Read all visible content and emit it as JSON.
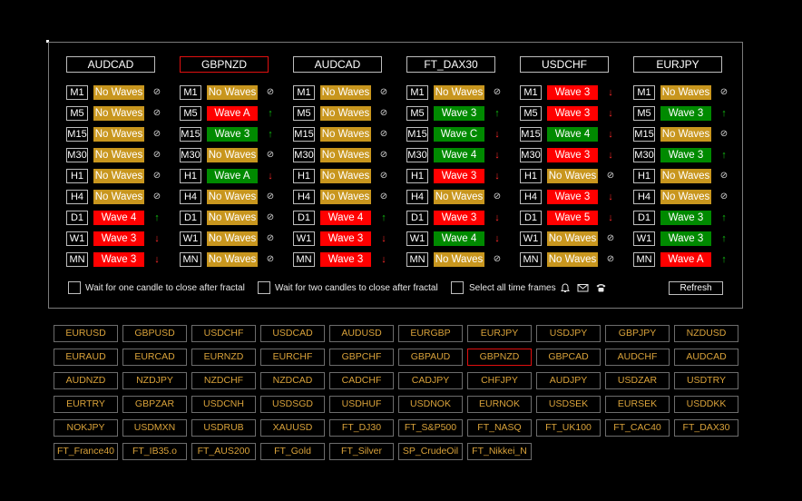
{
  "columns": [
    {
      "symbol": "AUDCAD",
      "selected": false,
      "rows": [
        {
          "tf": "M1",
          "wave": "No Waves",
          "state": "none",
          "dir": "flat"
        },
        {
          "tf": "M5",
          "wave": "No Waves",
          "state": "none",
          "dir": "flat"
        },
        {
          "tf": "M15",
          "wave": "No Waves",
          "state": "none",
          "dir": "flat"
        },
        {
          "tf": "M30",
          "wave": "No Waves",
          "state": "none",
          "dir": "flat"
        },
        {
          "tf": "H1",
          "wave": "No Waves",
          "state": "none",
          "dir": "flat"
        },
        {
          "tf": "H4",
          "wave": "No Waves",
          "state": "none",
          "dir": "flat"
        },
        {
          "tf": "D1",
          "wave": "Wave 4",
          "state": "red",
          "dir": "up"
        },
        {
          "tf": "W1",
          "wave": "Wave 3",
          "state": "red",
          "dir": "down"
        },
        {
          "tf": "MN",
          "wave": "Wave 3",
          "state": "red",
          "dir": "down"
        }
      ]
    },
    {
      "symbol": "GBPNZD",
      "selected": true,
      "rows": [
        {
          "tf": "M1",
          "wave": "No Waves",
          "state": "none",
          "dir": "flat"
        },
        {
          "tf": "M5",
          "wave": "Wave A",
          "state": "red",
          "dir": "up"
        },
        {
          "tf": "M15",
          "wave": "Wave 3",
          "state": "green",
          "dir": "up"
        },
        {
          "tf": "M30",
          "wave": "No Waves",
          "state": "none",
          "dir": "flat"
        },
        {
          "tf": "H1",
          "wave": "Wave A",
          "state": "green",
          "dir": "down"
        },
        {
          "tf": "H4",
          "wave": "No Waves",
          "state": "none",
          "dir": "flat"
        },
        {
          "tf": "D1",
          "wave": "No Waves",
          "state": "none",
          "dir": "flat"
        },
        {
          "tf": "W1",
          "wave": "No Waves",
          "state": "none",
          "dir": "flat"
        },
        {
          "tf": "MN",
          "wave": "No Waves",
          "state": "none",
          "dir": "flat"
        }
      ]
    },
    {
      "symbol": "AUDCAD",
      "selected": false,
      "rows": [
        {
          "tf": "M1",
          "wave": "No Waves",
          "state": "none",
          "dir": "flat"
        },
        {
          "tf": "M5",
          "wave": "No Waves",
          "state": "none",
          "dir": "flat"
        },
        {
          "tf": "M15",
          "wave": "No Waves",
          "state": "none",
          "dir": "flat"
        },
        {
          "tf": "M30",
          "wave": "No Waves",
          "state": "none",
          "dir": "flat"
        },
        {
          "tf": "H1",
          "wave": "No Waves",
          "state": "none",
          "dir": "flat"
        },
        {
          "tf": "H4",
          "wave": "No Waves",
          "state": "none",
          "dir": "flat"
        },
        {
          "tf": "D1",
          "wave": "Wave 4",
          "state": "red",
          "dir": "up"
        },
        {
          "tf": "W1",
          "wave": "Wave 3",
          "state": "red",
          "dir": "down"
        },
        {
          "tf": "MN",
          "wave": "Wave 3",
          "state": "red",
          "dir": "down"
        }
      ]
    },
    {
      "symbol": "FT_DAX30",
      "selected": false,
      "rows": [
        {
          "tf": "M1",
          "wave": "No Waves",
          "state": "none",
          "dir": "flat"
        },
        {
          "tf": "M5",
          "wave": "Wave 3",
          "state": "green",
          "dir": "up"
        },
        {
          "tf": "M15",
          "wave": "Wave C",
          "state": "green",
          "dir": "down"
        },
        {
          "tf": "M30",
          "wave": "Wave 4",
          "state": "green",
          "dir": "down"
        },
        {
          "tf": "H1",
          "wave": "Wave 3",
          "state": "red",
          "dir": "down"
        },
        {
          "tf": "H4",
          "wave": "No Waves",
          "state": "none",
          "dir": "flat"
        },
        {
          "tf": "D1",
          "wave": "Wave 3",
          "state": "red",
          "dir": "down"
        },
        {
          "tf": "W1",
          "wave": "Wave 4",
          "state": "green",
          "dir": "down"
        },
        {
          "tf": "MN",
          "wave": "No Waves",
          "state": "none",
          "dir": "flat"
        }
      ]
    },
    {
      "symbol": "USDCHF",
      "selected": false,
      "rows": [
        {
          "tf": "M1",
          "wave": "Wave 3",
          "state": "red",
          "dir": "down"
        },
        {
          "tf": "M5",
          "wave": "Wave 3",
          "state": "red",
          "dir": "down"
        },
        {
          "tf": "M15",
          "wave": "Wave 4",
          "state": "green",
          "dir": "down"
        },
        {
          "tf": "M30",
          "wave": "Wave 3",
          "state": "red",
          "dir": "down"
        },
        {
          "tf": "H1",
          "wave": "No Waves",
          "state": "none",
          "dir": "flat"
        },
        {
          "tf": "H4",
          "wave": "Wave 3",
          "state": "red",
          "dir": "down"
        },
        {
          "tf": "D1",
          "wave": "Wave 5",
          "state": "red",
          "dir": "down"
        },
        {
          "tf": "W1",
          "wave": "No Waves",
          "state": "none",
          "dir": "flat"
        },
        {
          "tf": "MN",
          "wave": "No Waves",
          "state": "none",
          "dir": "flat"
        }
      ]
    },
    {
      "symbol": "EURJPY",
      "selected": false,
      "rows": [
        {
          "tf": "M1",
          "wave": "No Waves",
          "state": "none",
          "dir": "flat"
        },
        {
          "tf": "M5",
          "wave": "Wave 3",
          "state": "green",
          "dir": "up"
        },
        {
          "tf": "M15",
          "wave": "No Waves",
          "state": "none",
          "dir": "flat"
        },
        {
          "tf": "M30",
          "wave": "Wave 3",
          "state": "green",
          "dir": "up"
        },
        {
          "tf": "H1",
          "wave": "No Waves",
          "state": "none",
          "dir": "flat"
        },
        {
          "tf": "H4",
          "wave": "No Waves",
          "state": "none",
          "dir": "flat"
        },
        {
          "tf": "D1",
          "wave": "Wave 3",
          "state": "green",
          "dir": "up"
        },
        {
          "tf": "W1",
          "wave": "Wave 3",
          "state": "green",
          "dir": "up"
        },
        {
          "tf": "MN",
          "wave": "Wave A",
          "state": "red",
          "dir": "up"
        }
      ]
    }
  ],
  "glyphs": {
    "up": "↑",
    "down": "↓",
    "flat": "⊘"
  },
  "options": {
    "wait_one": "Wait for one candle to close after fractal",
    "wait_two": "Wait for two candles to close after fractal",
    "select_all": "Select all time frames",
    "refresh": "Refresh"
  },
  "icons": {
    "bell": "bell-icon",
    "mail": "mail-icon",
    "phone": "phone-icon"
  },
  "colors": {
    "none": "#c8961e",
    "red": "#ff0000",
    "green": "#008a00",
    "symbol_text": "#d9a23a",
    "selected_border": "#e01010"
  },
  "symbols": [
    [
      "EURUSD",
      "GBPUSD",
      "USDCHF",
      "USDCAD",
      "AUDUSD",
      "EURGBP",
      "EURJPY",
      "USDJPY",
      "GBPJPY",
      "NZDUSD"
    ],
    [
      "EURAUD",
      "EURCAD",
      "EURNZD",
      "EURCHF",
      "GBPCHF",
      "GBPAUD",
      "GBPNZD",
      "GBPCAD",
      "AUDCHF",
      "AUDCAD"
    ],
    [
      "AUDNZD",
      "NZDJPY",
      "NZDCHF",
      "NZDCAD",
      "CADCHF",
      "CADJPY",
      "CHFJPY",
      "AUDJPY",
      "USDZAR",
      "USDTRY"
    ],
    [
      "EURTRY",
      "GBPZAR",
      "USDCNH",
      "USDSGD",
      "USDHUF",
      "USDNOK",
      "EURNOK",
      "USDSEK",
      "EURSEK",
      "USDDKK"
    ],
    [
      "NOKJPY",
      "USDMXN",
      "USDRUB",
      "XAUUSD",
      "FT_DJ30",
      "FT_S&P500",
      "FT_NASQ",
      "FT_UK100",
      "FT_CAC40",
      "FT_DAX30"
    ],
    [
      "FT_France40",
      "FT_IB35.o",
      "FT_AUS200",
      "FT_Gold",
      "FT_Silver",
      "SP_CrudeOil",
      "FT_Nikkei_N"
    ]
  ],
  "selected_symbol": "GBPNZD"
}
